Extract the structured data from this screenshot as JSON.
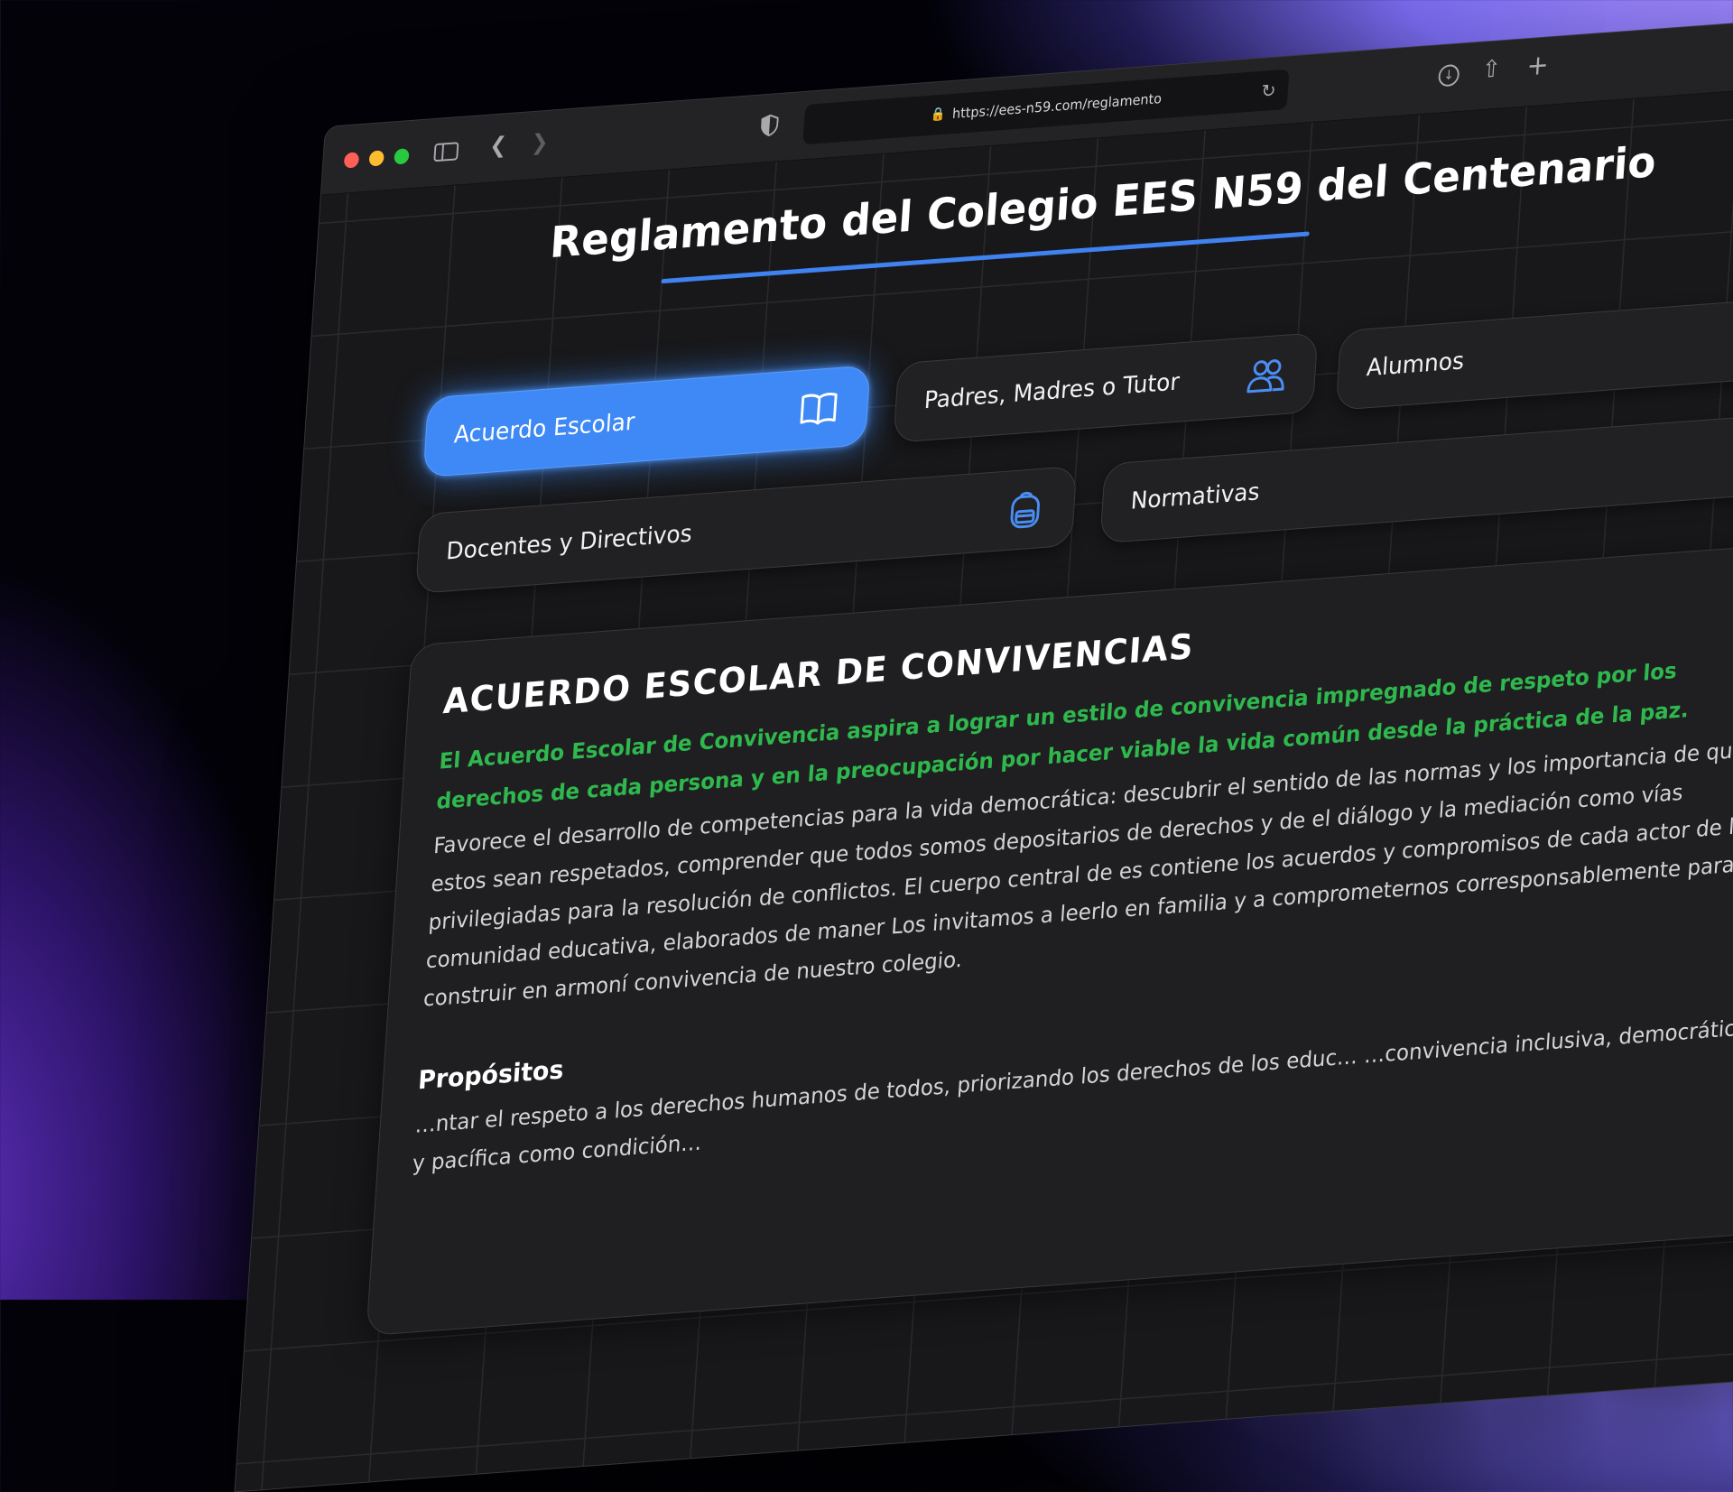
{
  "browser": {
    "url": "https://ees-n59.com/reglamento"
  },
  "page": {
    "title": "Reglamento del Colegio EES N59 del Centenario"
  },
  "nav_cards": [
    {
      "label": "Acuerdo Escolar",
      "icon": "open-book-icon",
      "active": true
    },
    {
      "label": "Padres, Madres o Tutor",
      "icon": "users-icon",
      "active": false
    },
    {
      "label": "Alumnos",
      "icon": "",
      "active": false
    },
    {
      "label": "Docentes y Directivos",
      "icon": "backpack-icon",
      "active": false
    },
    {
      "label": "Normativas",
      "icon": "",
      "active": false
    }
  ],
  "section": {
    "title": "ACUERDO ESCOLAR DE CONVIVENCIAS",
    "lead": "El Acuerdo Escolar de Convivencia aspira a lograr un estilo de convivencia impregnado de respeto por los derechos de cada persona y en la preocupación por hacer viable la vida común desde la práctica de la paz.",
    "body": "Favorece el desarrollo de competencias para la vida democrática: descubrir el sentido de las normas y los importancia de que estos sean respetados, comprender que todos somos depositarios de derechos y de el diálogo y la mediación como vías privilegiadas para la resolución de conflictos. El cuerpo central de es contiene los acuerdos y compromisos de cada actor de la comunidad educativa, elaborados de maner Los invitamos a leerlo en familia y a comprometernos corresponsablemente para construir en armoní convivencia de nuestro colegio.",
    "purposes_heading": "Propósitos",
    "purposes_text": "…ntar el respeto a los derechos humanos de todos, priorizando los derechos de los educ… …convivencia inclusiva, democrática y pacífica como condición…"
  },
  "colors": {
    "accent_blue": "#3e89f5",
    "lead_green": "#2fb84d",
    "page_bg": "#18181a"
  }
}
